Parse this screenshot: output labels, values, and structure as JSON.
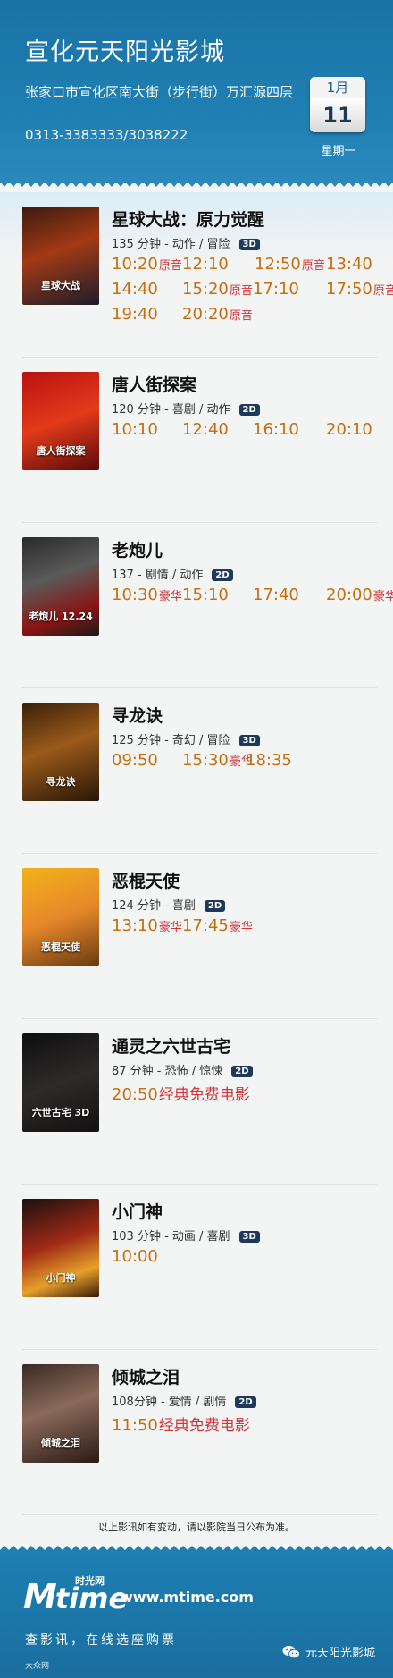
{
  "header": {
    "title": "宣化元天阳光影城",
    "address": "张家口市宣化区南大街（步行街）万汇源四层",
    "phone": "0313-3383333/3038222",
    "date": {
      "month": "1月",
      "day": "11",
      "weekday": "星期一"
    }
  },
  "movies": [
    {
      "title": "星球大战：原力觉醒",
      "info": "135 分钟 - 动作 / 冒险",
      "format": "3D",
      "poster_text": "星球大战",
      "showtimes": [
        {
          "time": "10:20",
          "tag": "原音"
        },
        {
          "time": "12:10",
          "tag": ""
        },
        {
          "time": "12:50",
          "tag": "原音"
        },
        {
          "time": "13:40",
          "tag": ""
        },
        {
          "time": "14:40",
          "tag": ""
        },
        {
          "time": "15:20",
          "tag": "原音"
        },
        {
          "time": "17:10",
          "tag": ""
        },
        {
          "time": "17:50",
          "tag": "原音"
        },
        {
          "time": "19:40",
          "tag": ""
        },
        {
          "time": "20:20",
          "tag": "原音"
        }
      ]
    },
    {
      "title": "唐人街探案",
      "info": "120 分钟 - 喜剧 / 动作",
      "format": "2D",
      "poster_text": "唐人街探案",
      "showtimes": [
        {
          "time": "10:10",
          "tag": ""
        },
        {
          "time": "12:40",
          "tag": ""
        },
        {
          "time": "16:10",
          "tag": ""
        },
        {
          "time": "20:10",
          "tag": ""
        }
      ]
    },
    {
      "title": "老炮儿",
      "info": "137 - 剧情 / 动作",
      "format": "2D",
      "poster_text": "老炮儿 12.24",
      "showtimes": [
        {
          "time": "10:30",
          "tag": "豪华"
        },
        {
          "time": "15:10",
          "tag": ""
        },
        {
          "time": "17:40",
          "tag": ""
        },
        {
          "time": "20:00",
          "tag": "豪华"
        }
      ]
    },
    {
      "title": "寻龙诀",
      "info": "125 分钟 - 奇幻 / 冒险",
      "format": "3D",
      "poster_text": "寻龙诀",
      "showtimes": [
        {
          "time": "09:50",
          "tag": ""
        },
        {
          "time": "15:30",
          "tag": "豪华"
        },
        {
          "time": "18:35",
          "tag": ""
        }
      ]
    },
    {
      "title": "恶棍天使",
      "info": "124 分钟 - 喜剧",
      "format": "2D",
      "poster_text": "恶棍天使",
      "showtimes": [
        {
          "time": "13:10",
          "tag": "豪华"
        },
        {
          "time": "17:45",
          "tag": "豪华"
        }
      ]
    },
    {
      "title": "通灵之六世古宅",
      "info": "87 分钟 - 恐怖 / 惊悚",
      "format": "2D",
      "poster_text": "六世古宅 3D",
      "showtimes": [
        {
          "time": "20:50",
          "tag": "经典免费电影"
        }
      ]
    },
    {
      "title": "小门神",
      "info": "103 分钟 - 动画 / 喜剧",
      "format": "3D",
      "poster_text": "小门神",
      "showtimes": [
        {
          "time": "10:00",
          "tag": ""
        }
      ]
    },
    {
      "title": "倾城之泪",
      "info": "108分钟 - 爱情 / 剧情",
      "format": "2D",
      "poster_text": "倾城之泪",
      "showtimes": [
        {
          "time": "11:50",
          "tag": "经典免费电影"
        }
      ]
    }
  ],
  "notice": "以上影讯如有变动，请以影院当日公布为准。",
  "footer": {
    "logo_m": "M",
    "logo_time": "time",
    "logo_cn": "时光网",
    "site": "www.mtime.com",
    "slogan": "查影讯，在线选座购票",
    "brand": "大众网",
    "wechat": "元天阳光影城"
  },
  "colors": {
    "header_bg": "#1f7fb2",
    "time": "#c86e0e",
    "tag": "#d0353a",
    "badge": "#1d3a5a"
  }
}
